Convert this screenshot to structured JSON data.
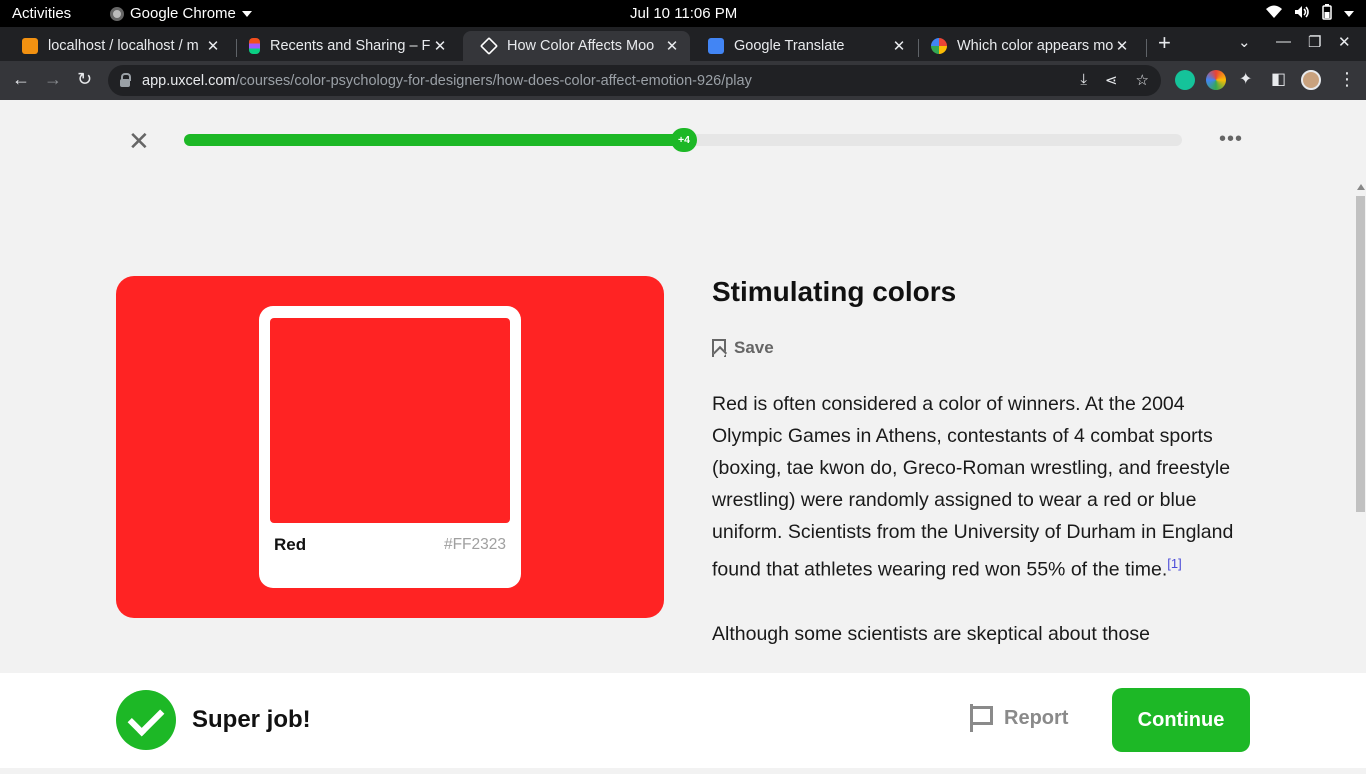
{
  "system_bar": {
    "activities": "Activities",
    "app_name": "Google Chrome",
    "clock": "Jul 10  11:06 PM"
  },
  "tabs": [
    {
      "title": "localhost / localhost / m",
      "favicon_color": "#f29111",
      "active": false
    },
    {
      "title": "Recents and Sharing – F",
      "favicon_color": "#a259ff",
      "active": false
    },
    {
      "title": "How Color Affects Moo",
      "favicon_color": "#ffffff",
      "active": true
    },
    {
      "title": "Google Translate",
      "favicon_color": "#4285f4",
      "active": false
    },
    {
      "title": "Which color appears mo",
      "favicon_color": "#ffffff",
      "active": false
    }
  ],
  "address_bar": {
    "host": "app.uxcel.com",
    "path": "/courses/color-psychology-for-designers/how-does-color-affect-emotion-926/play"
  },
  "lesson": {
    "progress_fraction": 0.5,
    "progress_badge": "+4",
    "title": "Stimulating colors",
    "save_label": "Save",
    "paragraph_1": "Red is often considered a color of winners. At the 2004 Olympic Games in Athens, contestants of 4 combat sports (boxing, tae kwon do, Greco-Roman wrestling, and freestyle wrestling) were randomly assigned to wear a red or blue uniform. Scientists from the University of Durham in England found that athletes wearing red won 55% of the time.",
    "footnote": "[1]",
    "paragraph_2": "Although some scientists are skeptical about those"
  },
  "swatch": {
    "name": "Red",
    "hex": "#FF2323"
  },
  "feedback": {
    "message": "Super job!",
    "report_label": "Report",
    "continue_label": "Continue"
  },
  "colors": {
    "accent_green": "#1db826",
    "swatch_red": "#ff2323"
  }
}
